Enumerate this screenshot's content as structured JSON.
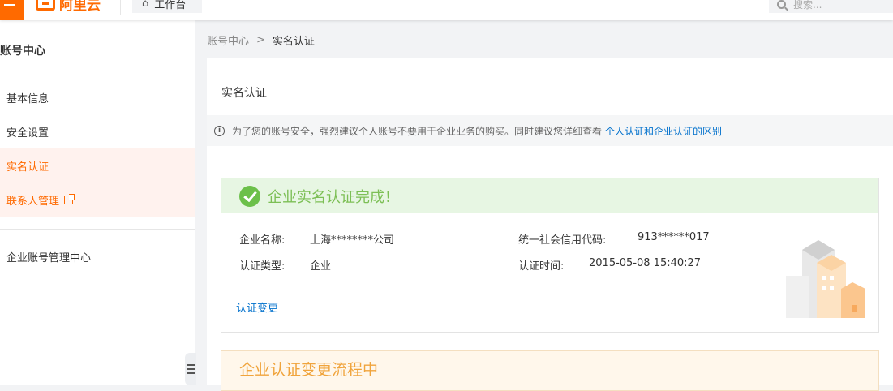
{
  "header": {
    "logo_text": "阿里云",
    "workbench_label": "工作台",
    "search_placeholder": "搜索..."
  },
  "sidebar": {
    "title": "账号中心",
    "items": [
      {
        "label": "基本信息"
      },
      {
        "label": "安全设置"
      },
      {
        "label": "实名认证"
      },
      {
        "label": "联系人管理"
      },
      {
        "label": "企业账号管理中心"
      }
    ]
  },
  "breadcrumb": {
    "root": "账号中心",
    "separator": ">",
    "current": "实名认证"
  },
  "page": {
    "title": "实名认证",
    "notice_text": "为了您的账号安全，强烈建议个人账号不要用于企业业务的购买。同时建议您详细查看",
    "notice_link": "个人认证和企业认证的区别"
  },
  "verification_card": {
    "status": "企业实名认证完成！",
    "company_name_label": "企业名称:",
    "company_name": "上海********公司",
    "type_label": "认证类型:",
    "type": "企业",
    "credit_code_label": "统一社会信用代码:",
    "credit_code": "913******017",
    "time_label": "认证时间:",
    "time": "2015-05-08 15:40:27",
    "change_link": "认证变更"
  },
  "change_card": {
    "title": "企业认证变更流程中"
  },
  "colors": {
    "brand": "#ff6a00",
    "link": "#0070cc",
    "success": "#6cc04a",
    "warning": "#f0a43c"
  }
}
